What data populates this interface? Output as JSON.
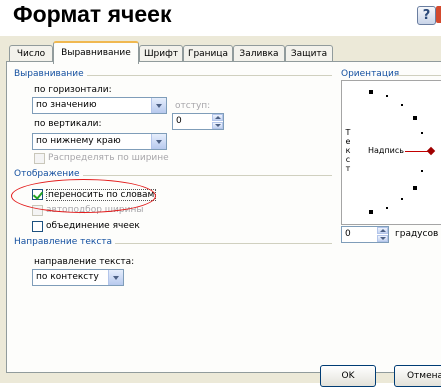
{
  "window": {
    "title": "Формат ячеек"
  },
  "tabs": [
    {
      "label": "Число"
    },
    {
      "label": "Выравнивание",
      "active": true
    },
    {
      "label": "Шрифт"
    },
    {
      "label": "Граница"
    },
    {
      "label": "Заливка"
    },
    {
      "label": "Защита"
    }
  ],
  "alignment": {
    "group_title": "Выравнивание",
    "horizontal_label": "по горизонтали:",
    "horizontal_value": "по значению",
    "indent_label": "отступ:",
    "indent_value": "0",
    "vertical_label": "по вертикали:",
    "vertical_value": "по нижнему краю",
    "distribute_label": "Распределять по ширине"
  },
  "display": {
    "group_title": "Отображение",
    "wrap_text_label": "переносить по словам",
    "wrap_text_checked": true,
    "shrink_label": "автоподбор ширины",
    "merge_label": "объединение ячеек",
    "merge_checked": false
  },
  "direction": {
    "group_title": "Направление текста",
    "label": "направление текста:",
    "value": "по контексту"
  },
  "orientation": {
    "group_title": "Ориентация",
    "vertical_text": "Т\nе\nк\nс\nт",
    "caption": "Надпись",
    "degrees_value": "0",
    "degrees_label": "градусов"
  },
  "buttons": {
    "ok": "OK",
    "cancel": "Отмена"
  },
  "colors": {
    "accent_tab": "#f0b84f",
    "highlight_ellipse": "#e31b1b",
    "group_title": "#1450a0"
  }
}
